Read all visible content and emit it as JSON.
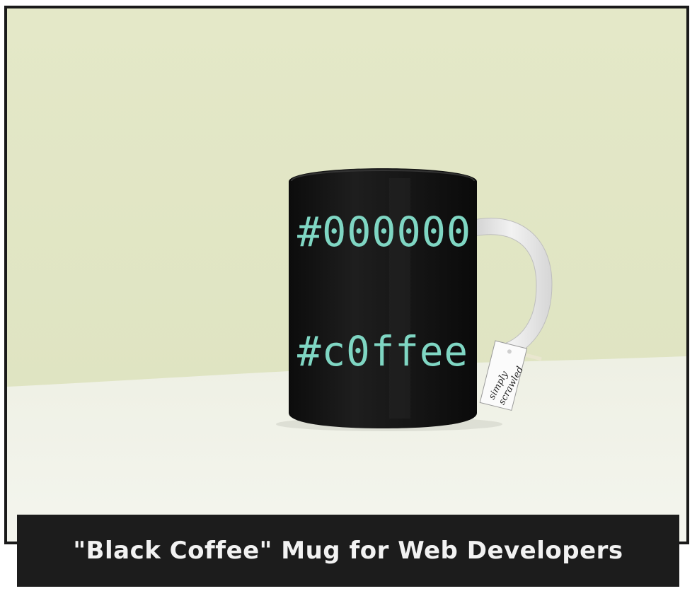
{
  "mug": {
    "line1": "#000000",
    "line2": "#c0ffee"
  },
  "tag": {
    "line1": "simply",
    "line2": "scrawled"
  },
  "caption": {
    "text": "\"Black Coffee\" Mug for Web Developers"
  },
  "colors": {
    "wall": "#e2e6c6",
    "table": "#f1f2ea",
    "mug_body": "#151515",
    "mug_text": "#7fd6c3",
    "caption_bg": "#1c1c1c",
    "caption_text": "#f2f2f2",
    "frame": "#1a1a1a"
  }
}
